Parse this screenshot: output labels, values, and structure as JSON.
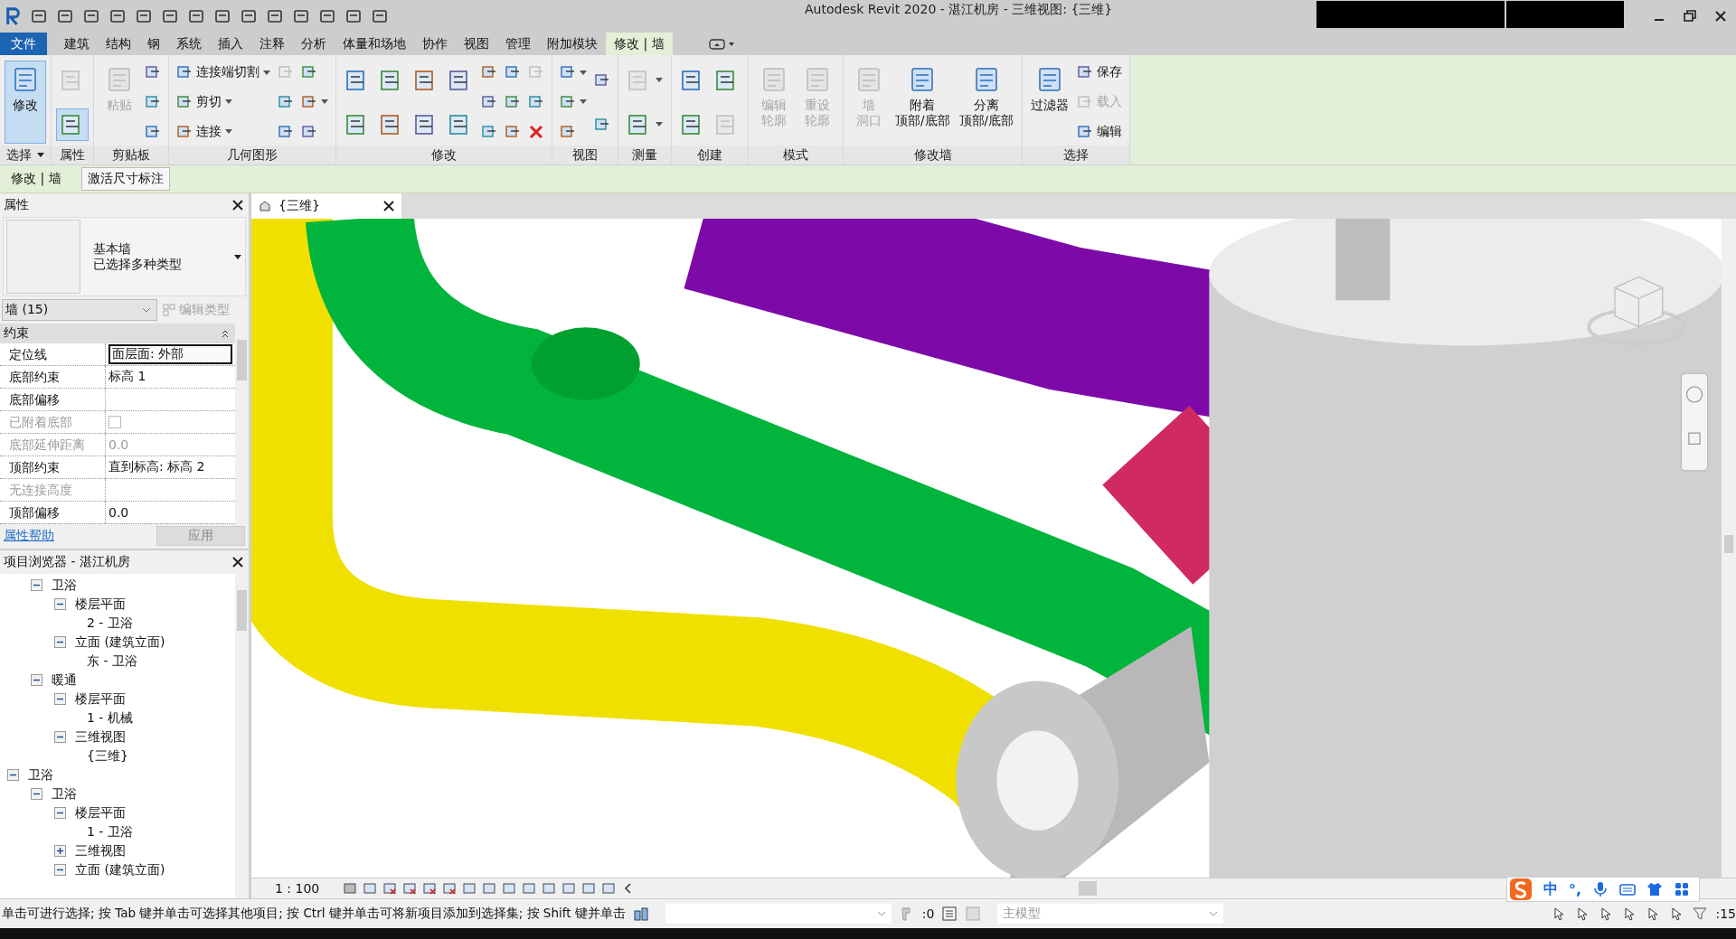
{
  "window": {
    "title": "Autodesk Revit 2020 - 湛江机房 - 三维视图: {三维}"
  },
  "tabs": [
    {
      "label": "文件",
      "kind": "file",
      "selected": false
    },
    {
      "label": "建筑",
      "kind": "tab",
      "selected": false
    },
    {
      "label": "结构",
      "kind": "tab",
      "selected": false
    },
    {
      "label": "钢",
      "kind": "tab",
      "selected": false
    },
    {
      "label": "系统",
      "kind": "tab",
      "selected": false
    },
    {
      "label": "插入",
      "kind": "tab",
      "selected": false
    },
    {
      "label": "注释",
      "kind": "tab",
      "selected": false
    },
    {
      "label": "分析",
      "kind": "tab",
      "selected": false
    },
    {
      "label": "体量和场地",
      "kind": "tab",
      "selected": false
    },
    {
      "label": "协作",
      "kind": "tab",
      "selected": false
    },
    {
      "label": "视图",
      "kind": "tab",
      "selected": false
    },
    {
      "label": "管理",
      "kind": "tab",
      "selected": false
    },
    {
      "label": "附加模块",
      "kind": "tab",
      "selected": false
    },
    {
      "label": "修改 | 墙",
      "kind": "tab",
      "selected": true
    }
  ],
  "ribbon": [
    {
      "label": "选择",
      "menu": true,
      "columns": [
        [
          {
            "kind": "large",
            "label": "修改",
            "on": true,
            "disabled": false
          }
        ]
      ]
    },
    {
      "label": "属性",
      "columns": [
        [
          {
            "kind": "medium",
            "on": false,
            "disabled": true
          },
          {
            "kind": "medium",
            "on": true,
            "disabled": false
          }
        ]
      ]
    },
    {
      "label": "剪贴板",
      "columns": [
        [
          {
            "kind": "large",
            "label": "粘贴",
            "on": false,
            "disabled": true
          }
        ],
        [
          {
            "kind": "small",
            "on": false,
            "disabled": false
          },
          {
            "kind": "small",
            "on": false,
            "disabled": false
          },
          {
            "kind": "small",
            "on": false,
            "disabled": false
          }
        ]
      ]
    },
    {
      "label": "几何图形",
      "columns": [
        [
          {
            "kind": "small",
            "label": "连接端切割",
            "menu": true,
            "on": false,
            "disabled": false
          },
          {
            "kind": "small",
            "label": "剪切",
            "menu": true,
            "on": false,
            "disabled": false
          },
          {
            "kind": "small",
            "label": "连接",
            "menu": true,
            "on": false,
            "disabled": false
          }
        ],
        [
          {
            "kind": "small",
            "on": false,
            "disabled": true
          },
          {
            "kind": "small",
            "on": false,
            "disabled": false
          },
          {
            "kind": "small",
            "on": false,
            "disabled": false
          }
        ],
        [
          {
            "kind": "small",
            "on": false,
            "disabled": false
          },
          {
            "kind": "small",
            "menu": true,
            "on": false,
            "disabled": false
          },
          {
            "kind": "small",
            "on": false,
            "disabled": false
          }
        ]
      ]
    },
    {
      "label": "修改",
      "columns": [
        [
          {
            "kind": "medium",
            "on": false,
            "disabled": false
          },
          {
            "kind": "medium",
            "on": false,
            "disabled": false
          }
        ],
        [
          {
            "kind": "medium",
            "on": false,
            "disabled": false
          },
          {
            "kind": "medium",
            "on": false,
            "disabled": false
          }
        ],
        [
          {
            "kind": "medium",
            "on": false,
            "disabled": false
          },
          {
            "kind": "medium",
            "on": false,
            "disabled": false
          }
        ],
        [
          {
            "kind": "medium",
            "on": false,
            "disabled": false
          },
          {
            "kind": "medium",
            "on": false,
            "disabled": false
          }
        ],
        [
          {
            "kind": "small",
            "on": false,
            "disabled": false
          },
          {
            "kind": "small",
            "on": false,
            "disabled": false
          },
          {
            "kind": "small",
            "on": false,
            "disabled": false
          }
        ],
        [
          {
            "kind": "small",
            "on": false,
            "disabled": false
          },
          {
            "kind": "small",
            "on": false,
            "disabled": false
          },
          {
            "kind": "small",
            "on": false,
            "disabled": false
          }
        ],
        [
          {
            "kind": "small",
            "on": false,
            "disabled": true
          },
          {
            "kind": "small",
            "on": false,
            "disabled": false
          },
          {
            "kind": "delete",
            "on": false,
            "disabled": false
          }
        ]
      ]
    },
    {
      "label": "视图",
      "columns": [
        [
          {
            "kind": "small",
            "menu": true,
            "on": false,
            "disabled": false
          },
          {
            "kind": "small",
            "menu": true,
            "on": false,
            "disabled": false
          },
          {
            "kind": "small",
            "on": false,
            "disabled": false
          }
        ],
        [
          {
            "kind": "small",
            "on": false,
            "disabled": false
          },
          {
            "kind": "small",
            "on": false,
            "disabled": false
          }
        ]
      ]
    },
    {
      "label": "测量",
      "columns": [
        [
          {
            "kind": "medium",
            "menu": true,
            "on": false,
            "disabled": true
          },
          {
            "kind": "medium",
            "menu": true,
            "on": false,
            "disabled": false
          }
        ]
      ]
    },
    {
      "label": "创建",
      "columns": [
        [
          {
            "kind": "medium",
            "on": false,
            "disabled": false
          },
          {
            "kind": "medium",
            "on": false,
            "disabled": false
          }
        ],
        [
          {
            "kind": "medium",
            "on": false,
            "disabled": false
          },
          {
            "kind": "medium",
            "on": false,
            "disabled": true
          }
        ]
      ]
    },
    {
      "label": "模式",
      "columns": [
        [
          {
            "kind": "large",
            "lines": [
              "编辑",
              "轮廓"
            ],
            "on": false,
            "disabled": true
          }
        ],
        [
          {
            "kind": "large",
            "lines": [
              "重设",
              "轮廓"
            ],
            "on": false,
            "disabled": true
          }
        ]
      ]
    },
    {
      "label": "修改墙",
      "columns": [
        [
          {
            "kind": "large",
            "lines": [
              "墙",
              "洞口"
            ],
            "on": false,
            "disabled": true
          }
        ],
        [
          {
            "kind": "large",
            "lines": [
              "附着",
              "顶部/底部"
            ],
            "on": false,
            "disabled": false
          }
        ],
        [
          {
            "kind": "large",
            "lines": [
              "分离",
              "顶部/底部"
            ],
            "on": false,
            "disabled": false
          }
        ]
      ]
    },
    {
      "label": "选择",
      "columns": [
        [
          {
            "kind": "large",
            "label": "过滤器",
            "on": false,
            "disabled": false
          }
        ],
        [
          {
            "kind": "small",
            "label": "保存",
            "on": false,
            "disabled": false
          },
          {
            "kind": "small",
            "label": "载入",
            "on": false,
            "disabled": true
          },
          {
            "kind": "small",
            "label": "编辑",
            "on": false,
            "disabled": false
          }
        ]
      ]
    }
  ],
  "context_bar": {
    "label": "修改 | 墙",
    "button": "激活尺寸标注"
  },
  "properties": {
    "title": "属性",
    "family": "基本墙",
    "type": "已选择多种类型",
    "filter": "墙 (15)",
    "edit_type": "编辑类型",
    "section": "约束",
    "rows": [
      {
        "label": "定位线",
        "value": "面层面: 外部",
        "kind": "text",
        "disabled": false,
        "editing": true
      },
      {
        "label": "底部约束",
        "value": "标高 1",
        "kind": "text",
        "disabled": false,
        "editing": false
      },
      {
        "label": "底部偏移",
        "kind": "text",
        "disabled": false
      },
      {
        "label": "已附着底部",
        "kind": "checkbox",
        "checked": false,
        "disabled": true
      },
      {
        "label": "底部延伸距离",
        "value": "0.0",
        "kind": "text",
        "disabled": true,
        "editing": false
      },
      {
        "label": "顶部约束",
        "value": "直到标高: 标高 2",
        "kind": "text",
        "disabled": false,
        "editing": false
      },
      {
        "label": "无连接高度",
        "kind": "text",
        "disabled": true
      },
      {
        "label": "顶部偏移",
        "value": "0.0",
        "kind": "text",
        "disabled": false,
        "editing": false
      }
    ],
    "help": "属性帮助",
    "apply": "应用"
  },
  "browser": {
    "title": "项目浏览器 - 湛江机房",
    "tree": [
      {
        "children": [
          {
            "label": "卫浴",
            "expanded": true,
            "children": [
              {
                "label": "楼层平面",
                "expanded": true,
                "children": [
                  {
                    "label": "2 - 卫浴"
                  }
                ]
              },
              {
                "label": "立面 (建筑立面)",
                "expanded": true,
                "children": [
                  {
                    "label": "东 - 卫浴"
                  }
                ]
              }
            ]
          },
          {
            "label": "暖通",
            "expanded": true,
            "children": [
              {
                "label": "楼层平面",
                "expanded": true,
                "children": [
                  {
                    "label": "1 - 机械"
                  }
                ]
              },
              {
                "label": "三维视图",
                "expanded": true,
                "children": [
                  {
                    "label": "{三维}"
                  }
                ]
              }
            ]
          }
        ]
      },
      {
        "label": "卫浴",
        "expanded": true,
        "children": [
          {
            "label": "卫浴",
            "expanded": true,
            "children": [
              {
                "label": "楼层平面",
                "expanded": true,
                "children": [
                  {
                    "label": "1 - 卫浴"
                  }
                ]
              },
              {
                "label": "三维视图",
                "expanded": false
              },
              {
                "label": "立面 (建筑立面)",
                "expanded": true
              }
            ]
          }
        ]
      }
    ]
  },
  "view": {
    "tab": "{三维}",
    "scale": "1 : 100"
  },
  "status_bar": {
    "message": "单击可进行选择; 按 Tab 键并单击可选择其他项目; 按 Ctrl 键并单击可将新项目添加到选择集; 按 Shift 键并单击",
    "count": ":0",
    "model": "主模型",
    "selection_count": ":15"
  },
  "ime": {
    "mode": "中",
    "punctuation": "°,"
  }
}
